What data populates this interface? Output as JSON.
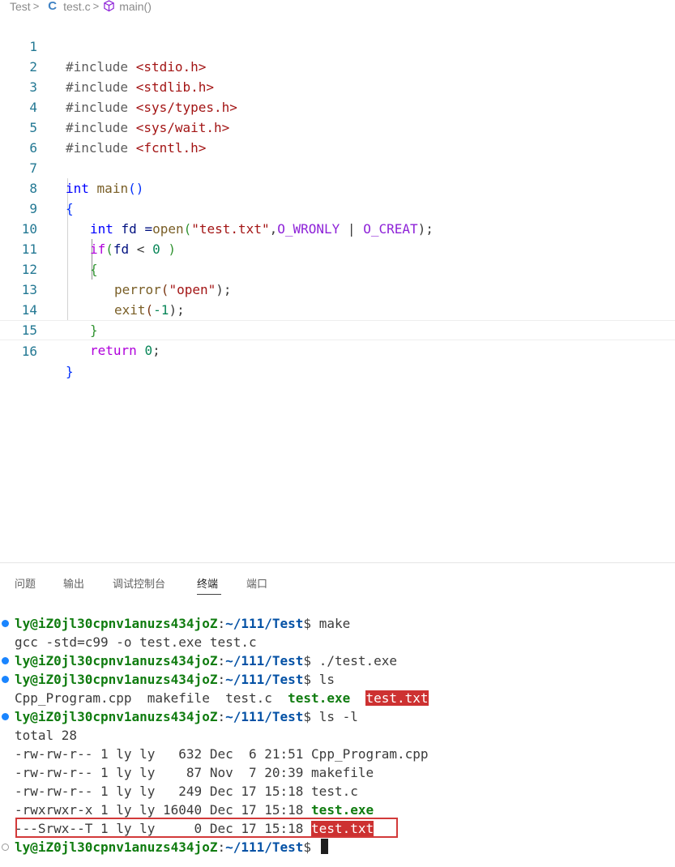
{
  "breadcrumb": {
    "folder": "Test",
    "file_icon": "c-language-icon",
    "file": "test.c",
    "symbol_icon": "function-cube-icon",
    "symbol": "main()"
  },
  "editor": {
    "line_numbers": [
      "1",
      "2",
      "3",
      "4",
      "5",
      "6",
      "7",
      "8",
      "9",
      "10",
      "11",
      "12",
      "13",
      "14",
      "15",
      "16"
    ],
    "colors": {
      "line_number": "#237893",
      "keyword": "#0000ff",
      "control": "#af00db",
      "string": "#a31515",
      "function": "#795e26",
      "number": "#098658",
      "macro": "#8e23d8"
    },
    "tokens": {
      "l1_a": "#include ",
      "l1_b": "<stdio.h>",
      "l2_a": "#include ",
      "l2_b": "<stdlib.h>",
      "l3_a": "#include ",
      "l3_b": "<sys/types.h>",
      "l4_a": "#include ",
      "l4_b": "<sys/wait.h>",
      "l5_a": "#include ",
      "l5_b": "<fcntl.h>",
      "l7_a": "int",
      "l7_b": " ",
      "l7_c": "main",
      "l7_d": "()",
      "l8_a": "{",
      "l9_a": "int",
      "l9_b": " fd =",
      "l9_c": "open",
      "l9_d": "(",
      "l9_e": "\"test.txt\"",
      "l9_f": ",",
      "l9_g": "O_WRONLY",
      "l9_h": " | ",
      "l9_i": "O_CREAT",
      "l9_j": ");",
      "l10_a": "if",
      "l10_b": "(",
      "l10_c": "fd",
      "l10_d": " < ",
      "l10_e": "0",
      "l10_f": " )",
      "l11_a": "{",
      "l12_a": "perror",
      "l12_b": "(",
      "l12_c": "\"open\"",
      "l12_d": ");",
      "l13_a": "exit",
      "l13_b": "(",
      "l13_c": "-1",
      "l13_d": ");",
      "l14_a": "}",
      "l15_a": "return",
      "l15_b": " ",
      "l15_c": "0",
      "l15_d": ";",
      "l16_a": "}"
    }
  },
  "panel": {
    "tabs": [
      {
        "label": "问题"
      },
      {
        "label": "输出"
      },
      {
        "label": "调试控制台"
      },
      {
        "label": "终端",
        "active": true
      },
      {
        "label": "端口"
      }
    ]
  },
  "terminal": {
    "user": "ly@iZ0jl30cpnv1anuzs434joZ",
    "colon": ":",
    "path": "~/111/Test",
    "dollar": "$ ",
    "cmd1": "make",
    "out1": "gcc -std=c99 -o test.exe test.c",
    "cmd2": "./test.exe",
    "cmd3": "ls",
    "ls_a": "Cpp_Program.cpp  makefile  test.c  ",
    "ls_exe": "test.exe",
    "ls_gap": "  ",
    "ls_txt": "test.txt",
    "cmd4": "ls -l",
    "total": "total 28",
    "row1": "-rw-rw-r-- 1 ly ly   632 Dec  6 21:51 Cpp_Program.cpp",
    "row2": "-rw-rw-r-- 1 ly ly    87 Nov  7 20:39 makefile",
    "row3": "-rw-rw-r-- 1 ly ly   249 Dec 17 15:18 test.c",
    "row4_a": "-rwxrwxr-x 1 ly ly 16040 Dec 17 15:18 ",
    "row4_b": "test.exe",
    "row5_a": "---Srwx--T 1 ly ly     0 Dec 17 15:18 ",
    "row5_b": "test.txt",
    "colors": {
      "success_dot": "#1a85ff",
      "user": "#107c10",
      "path": "#0451a5",
      "highlight_bg": "#cd3131",
      "box_outline": "#d23a3a"
    }
  }
}
